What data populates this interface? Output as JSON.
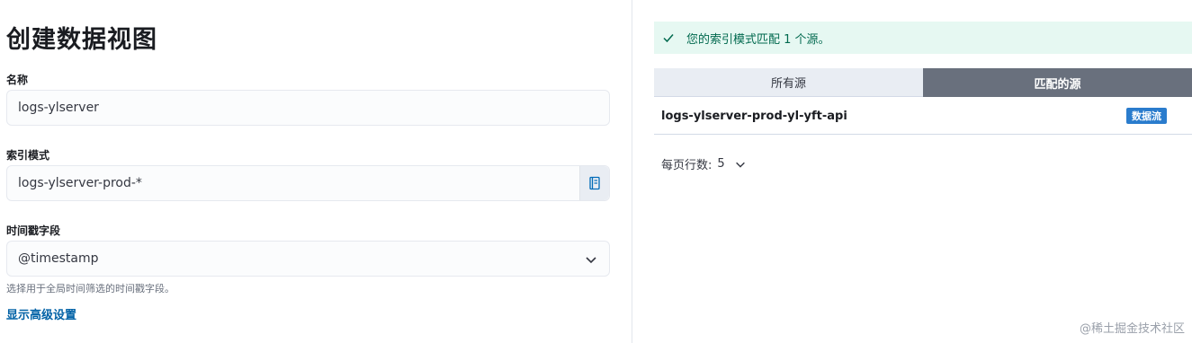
{
  "form": {
    "title": "创建数据视图",
    "name_label": "名称",
    "name_value": "logs-ylserver",
    "index_label": "索引模式",
    "index_value": "logs-ylserver-prod-*",
    "timestamp_label": "时间戳字段",
    "timestamp_value": "@timestamp",
    "timestamp_help": "选择用于全局时间筛选的时间戳字段。",
    "advanced_link": "显示高级设置"
  },
  "preview": {
    "callout_text": "您的索引模式匹配 1 个源。",
    "tabs": [
      {
        "label": "所有源",
        "selected": false
      },
      {
        "label": "匹配的源",
        "selected": true
      }
    ],
    "rows": [
      {
        "name": "logs-ylserver-prod-yl-yft-api",
        "badge": "数据流"
      }
    ],
    "rows_per_page_label": "每页行数:",
    "rows_per_page_value": "5"
  },
  "watermark": "@稀土掘金技术社区",
  "colors": {
    "accent_link": "#0061a6",
    "success_bg": "#e6f8f2",
    "success_text": "#00694e",
    "tab_selected_bg": "#69707d",
    "badge_bg": "#2a7ccd"
  },
  "icons": {
    "index_append": "book-icon",
    "select": "chevron-down-icon",
    "callout": "check-icon",
    "pager": "chevron-down-icon"
  }
}
